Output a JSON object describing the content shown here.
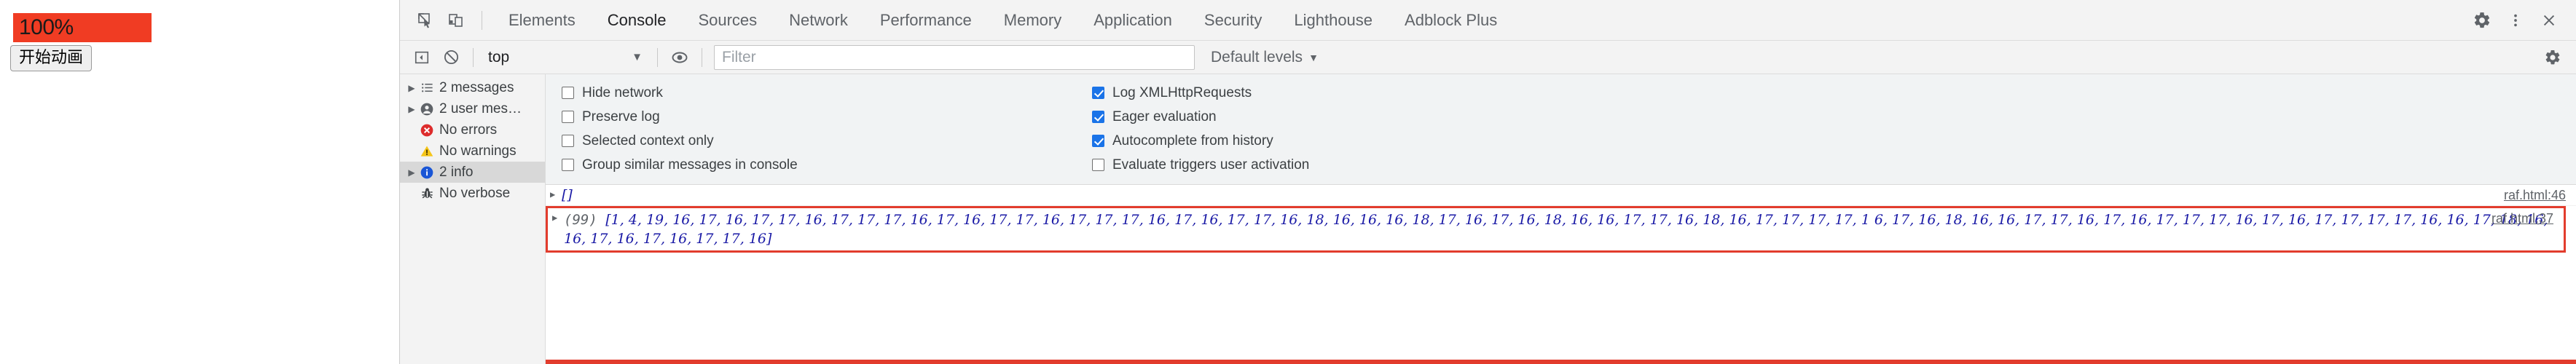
{
  "page": {
    "progress": {
      "label": "100%",
      "bar_color": "#f03c23",
      "value": 100
    },
    "start_button": {
      "label": "开始动画"
    }
  },
  "devtools": {
    "tabs": [
      {
        "label": "Elements",
        "active": false
      },
      {
        "label": "Console",
        "active": true
      },
      {
        "label": "Sources",
        "active": false
      },
      {
        "label": "Network",
        "active": false
      },
      {
        "label": "Performance",
        "active": false
      },
      {
        "label": "Memory",
        "active": false
      },
      {
        "label": "Application",
        "active": false
      },
      {
        "label": "Security",
        "active": false
      },
      {
        "label": "Lighthouse",
        "active": false
      },
      {
        "label": "Adblock Plus",
        "active": false
      }
    ],
    "toolbar_icons": {
      "inspect": "inspect-element-icon",
      "device": "device-toolbar-icon",
      "settings": "settings-gear-icon",
      "more": "more-options-icon",
      "close": "close-icon"
    },
    "filterbar": {
      "sidebar_toggle": "console-sidebar-icon",
      "clear": "clear-console-icon",
      "context": "top",
      "context_caret": "▼",
      "live_expression": "eye-icon",
      "filter_placeholder": "Filter",
      "filter_value": "",
      "levels_label": "Default levels",
      "levels_caret": "▼",
      "settings": "console-settings-gear-icon"
    },
    "sidebar": [
      {
        "label": "2 messages",
        "icon": "list-icon",
        "expandable": true,
        "selected": false
      },
      {
        "label": "2 user mes…",
        "icon": "user-icon",
        "expandable": true,
        "selected": false
      },
      {
        "label": "No errors",
        "icon": "error-icon",
        "expandable": false,
        "selected": false
      },
      {
        "label": "No warnings",
        "icon": "warning-icon",
        "expandable": false,
        "selected": false
      },
      {
        "label": "2 info",
        "icon": "info-icon",
        "expandable": true,
        "selected": true
      },
      {
        "label": "No verbose",
        "icon": "bug-icon",
        "expandable": false,
        "selected": false
      }
    ],
    "settings_checkboxes_left": [
      {
        "label": "Hide network",
        "checked": false
      },
      {
        "label": "Preserve log",
        "checked": false
      },
      {
        "label": "Selected context only",
        "checked": false
      },
      {
        "label": "Group similar messages in console",
        "checked": false
      }
    ],
    "settings_checkboxes_right": [
      {
        "label": "Log XMLHttpRequests",
        "checked": true
      },
      {
        "label": "Eager evaluation",
        "checked": true
      },
      {
        "label": "Autocomplete from history",
        "checked": true
      },
      {
        "label": "Evaluate triggers user activation",
        "checked": false
      }
    ],
    "messages": [
      {
        "arrow": "▶",
        "text": "[]",
        "source": "raf.html:46",
        "highlight": false
      },
      {
        "arrow": "▶",
        "length_label": "(99)",
        "text": "[1, 4, 19, 16, 17, 16, 17, 17, 16, 17, 17, 17, 16, 17, 16, 17, 17, 16, 17, 17, 17, 16, 17, 16, 17, 17, 16, 18, 16, 16, 16, 18, 17, 16, 17, 16, 18, 16, 16, 17, 17, 16, 18, 16, 17, 17, 17, 17, 1 6, 17, 16, 18, 16, 16, 17, 17, 16, 17, 16, 17, 17, 17, 16, 17, 16, 17, 17, 17, 17, 16, 16, 17, 18, 16, 16, 17, 16, 17, 16, 17, 17, 16]",
        "source": "raf.html:37",
        "highlight": true
      }
    ]
  }
}
